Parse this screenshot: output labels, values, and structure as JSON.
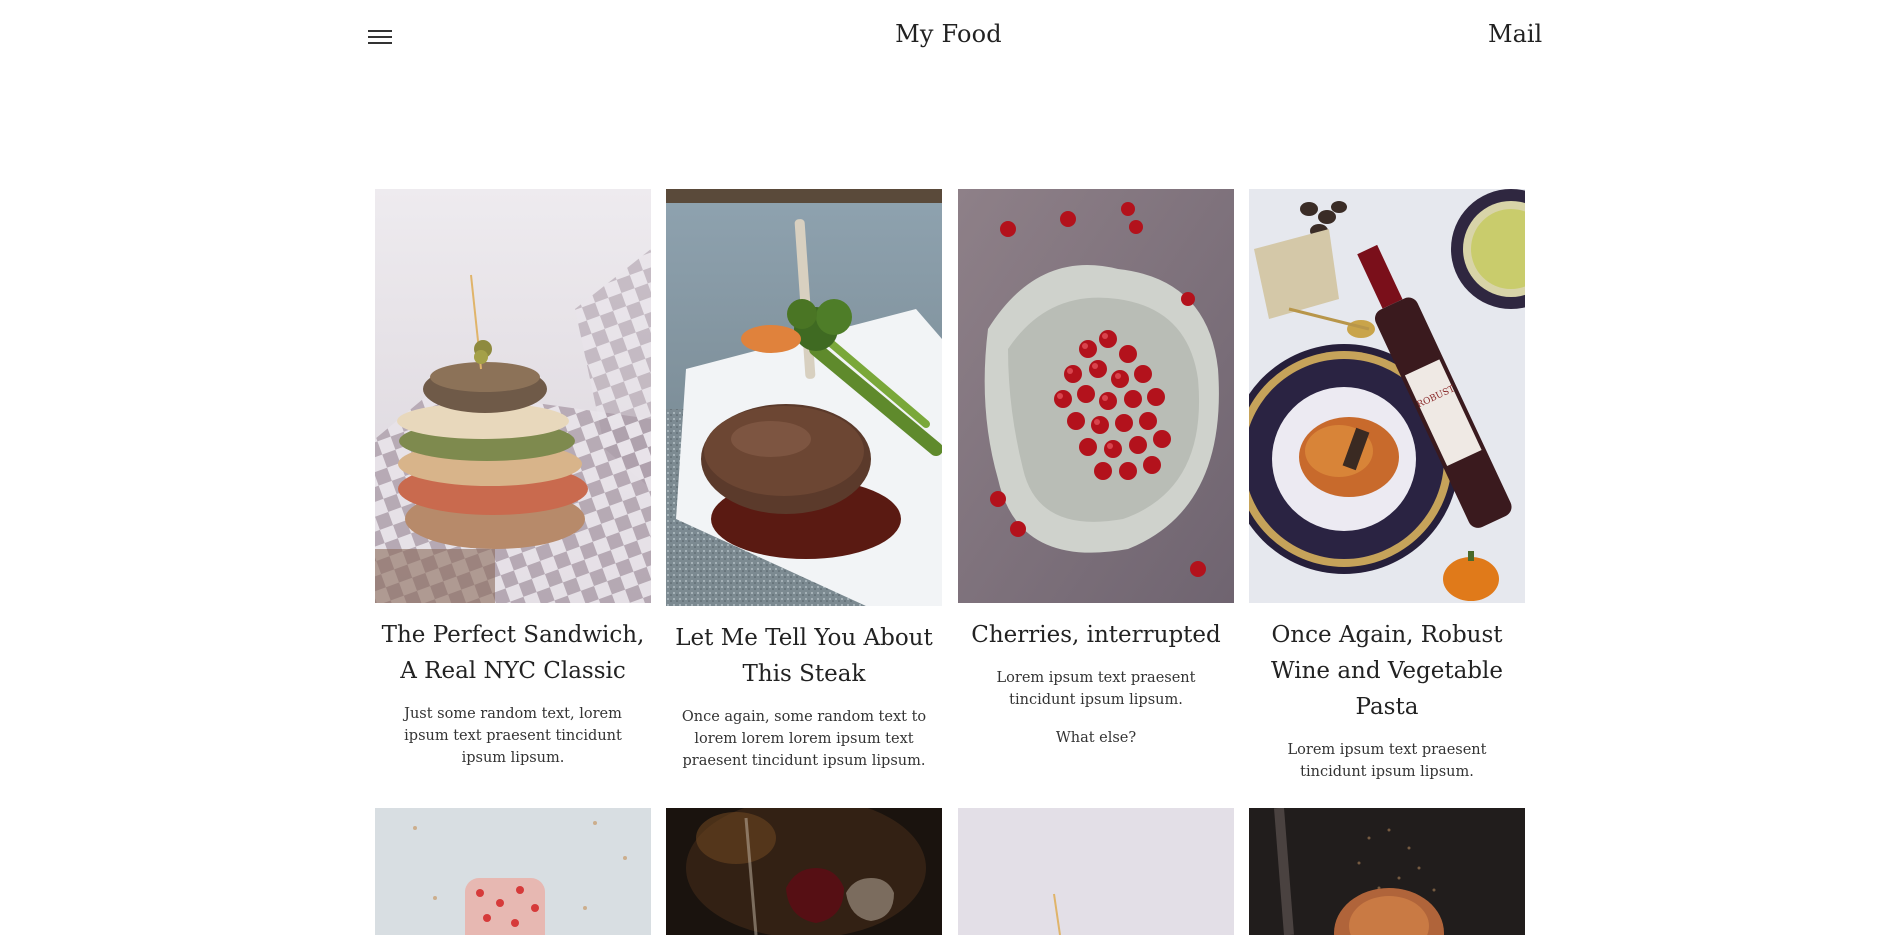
{
  "header": {
    "title": "My Food",
    "mail_label": "Mail",
    "menu_icon": "hamburger-menu-icon"
  },
  "posts": [
    {
      "title": "The Perfect Sandwich, A Real NYC Classic",
      "paragraphs": [
        "Just some random text, lorem ipsum text praesent tincidunt ipsum lipsum."
      ],
      "image": "sandwich-photo"
    },
    {
      "title": "Let Me Tell You About This Steak",
      "paragraphs": [
        "Once again, some random text to lorem lorem lorem ipsum text praesent tincidunt ipsum lipsum."
      ],
      "image": "steak-photo"
    },
    {
      "title": "Cherries, interrupted",
      "paragraphs": [
        "Lorem ipsum text praesent tincidunt ipsum lipsum.",
        "What else?"
      ],
      "image": "cherries-photo"
    },
    {
      "title": "Once Again, Robust Wine and Vegetable Pasta",
      "paragraphs": [
        "Lorem ipsum text praesent tincidunt ipsum lipsum."
      ],
      "image": "wine-pasta-photo"
    }
  ],
  "second_row_images": [
    "popsicle-photo",
    "wine-glasses-photo",
    "sandwich-photo",
    "croissant-photo"
  ],
  "colors": {
    "background": "#ffffff",
    "text": "#222222"
  }
}
